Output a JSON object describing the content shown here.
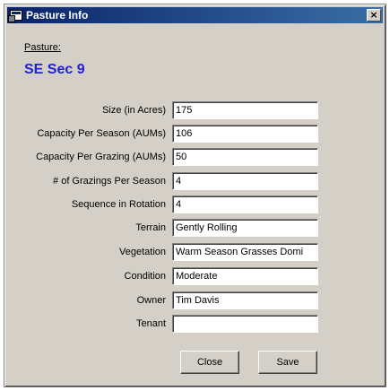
{
  "window": {
    "title": "Pasture Info",
    "close_glyph": "×"
  },
  "pasture": {
    "label": "Pasture:",
    "name": "SE Sec 9"
  },
  "fields": [
    {
      "label": "Size (in Acres)",
      "value": "175"
    },
    {
      "label": "Capacity Per Season (AUMs)",
      "value": "106"
    },
    {
      "label": "Capacity Per Grazing (AUMs)",
      "value": "50"
    },
    {
      "label": "# of Grazings Per Season",
      "value": "4"
    },
    {
      "label": "Sequence in Rotation",
      "value": "4"
    },
    {
      "label": "Terrain",
      "value": "Gently Rolling"
    },
    {
      "label": "Vegetation",
      "value": "Warm Season Grasses Domi"
    },
    {
      "label": "Condition",
      "value": "Moderate"
    },
    {
      "label": "Owner",
      "value": "Tim Davis"
    },
    {
      "label": "Tenant",
      "value": ""
    }
  ],
  "buttons": {
    "close_label": "Close",
    "save_label": "Save"
  },
  "colors": {
    "title_bar": "#0a246a",
    "pasture_name": "#2222cc",
    "dialog_face": "#d4d0c8"
  }
}
